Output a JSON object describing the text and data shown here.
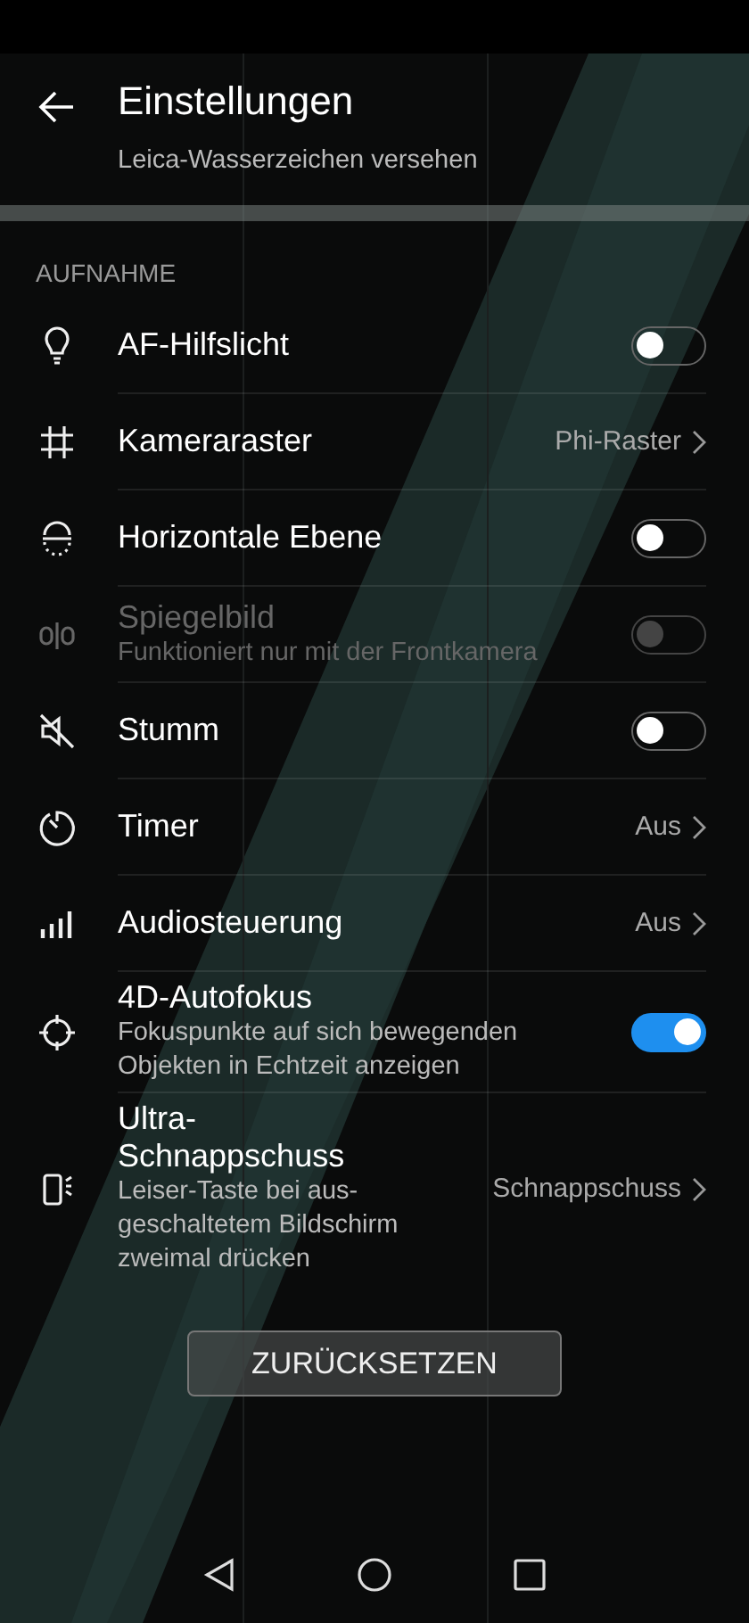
{
  "header": {
    "title": "Einstellungen",
    "subtitle": "Leica-Wasserzeichen versehen"
  },
  "section": {
    "title": "AUFNAHME"
  },
  "rows": [
    {
      "kind": "toggle",
      "title": "AF-Hilfslicht",
      "on": false,
      "disabled": false
    },
    {
      "kind": "value",
      "title": "Kameraraster",
      "value": "Phi-Raster",
      "disabled": false
    },
    {
      "kind": "toggle",
      "title": "Horizontale Ebene",
      "on": false,
      "disabled": false
    },
    {
      "kind": "toggle",
      "title": "Spiegelbild",
      "subtitle": "Funktioniert nur mit der Frontkamera",
      "on": false,
      "disabled": true
    },
    {
      "kind": "toggle",
      "title": "Stumm",
      "on": false,
      "disabled": false
    },
    {
      "kind": "value",
      "title": "Timer",
      "value": "Aus",
      "disabled": false
    },
    {
      "kind": "value",
      "title": "Audiosteuerung",
      "value": "Aus",
      "disabled": false
    },
    {
      "kind": "toggle",
      "title": "4D-Autofokus",
      "subtitle": "Fokuspunkte auf sich bewegenden Objekten in Echtzeit anzeigen",
      "on": true,
      "disabled": false
    },
    {
      "kind": "value",
      "title": "Ultra-Schnappschuss",
      "subtitle": "Leiser-Taste bei aus-geschaltetem Bildschirm zweimal drücken",
      "value": "Schnappschuss",
      "disabled": false
    }
  ],
  "reset_button": {
    "label": "ZURÜCKSETZEN"
  }
}
